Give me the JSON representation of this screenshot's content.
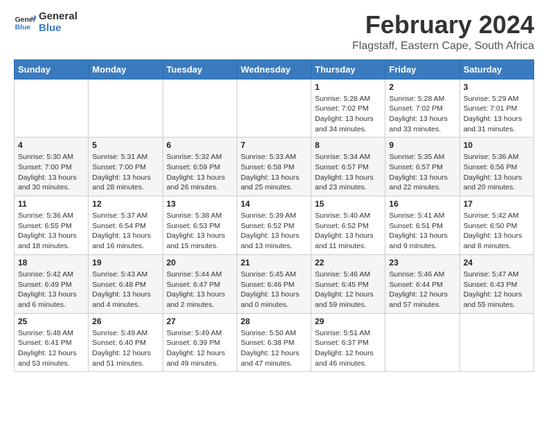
{
  "logo": {
    "text_general": "General",
    "text_blue": "Blue"
  },
  "header": {
    "title": "February 2024",
    "subtitle": "Flagstaff, Eastern Cape, South Africa"
  },
  "days_of_week": [
    "Sunday",
    "Monday",
    "Tuesday",
    "Wednesday",
    "Thursday",
    "Friday",
    "Saturday"
  ],
  "weeks": [
    {
      "cells": [
        {
          "day": "",
          "info": ""
        },
        {
          "day": "",
          "info": ""
        },
        {
          "day": "",
          "info": ""
        },
        {
          "day": "",
          "info": ""
        },
        {
          "day": "1",
          "info": "Sunrise: 5:28 AM\nSunset: 7:02 PM\nDaylight: 13 hours\nand 34 minutes."
        },
        {
          "day": "2",
          "info": "Sunrise: 5:28 AM\nSunset: 7:02 PM\nDaylight: 13 hours\nand 33 minutes."
        },
        {
          "day": "3",
          "info": "Sunrise: 5:29 AM\nSunset: 7:01 PM\nDaylight: 13 hours\nand 31 minutes."
        }
      ]
    },
    {
      "cells": [
        {
          "day": "4",
          "info": "Sunrise: 5:30 AM\nSunset: 7:00 PM\nDaylight: 13 hours\nand 30 minutes."
        },
        {
          "day": "5",
          "info": "Sunrise: 5:31 AM\nSunset: 7:00 PM\nDaylight: 13 hours\nand 28 minutes."
        },
        {
          "day": "6",
          "info": "Sunrise: 5:32 AM\nSunset: 6:59 PM\nDaylight: 13 hours\nand 26 minutes."
        },
        {
          "day": "7",
          "info": "Sunrise: 5:33 AM\nSunset: 6:58 PM\nDaylight: 13 hours\nand 25 minutes."
        },
        {
          "day": "8",
          "info": "Sunrise: 5:34 AM\nSunset: 6:57 PM\nDaylight: 13 hours\nand 23 minutes."
        },
        {
          "day": "9",
          "info": "Sunrise: 5:35 AM\nSunset: 6:57 PM\nDaylight: 13 hours\nand 22 minutes."
        },
        {
          "day": "10",
          "info": "Sunrise: 5:36 AM\nSunset: 6:56 PM\nDaylight: 13 hours\nand 20 minutes."
        }
      ]
    },
    {
      "cells": [
        {
          "day": "11",
          "info": "Sunrise: 5:36 AM\nSunset: 6:55 PM\nDaylight: 13 hours\nand 18 minutes."
        },
        {
          "day": "12",
          "info": "Sunrise: 5:37 AM\nSunset: 6:54 PM\nDaylight: 13 hours\nand 16 minutes."
        },
        {
          "day": "13",
          "info": "Sunrise: 5:38 AM\nSunset: 6:53 PM\nDaylight: 13 hours\nand 15 minutes."
        },
        {
          "day": "14",
          "info": "Sunrise: 5:39 AM\nSunset: 6:52 PM\nDaylight: 13 hours\nand 13 minutes."
        },
        {
          "day": "15",
          "info": "Sunrise: 5:40 AM\nSunset: 6:52 PM\nDaylight: 13 hours\nand 11 minutes."
        },
        {
          "day": "16",
          "info": "Sunrise: 5:41 AM\nSunset: 6:51 PM\nDaylight: 13 hours\nand 9 minutes."
        },
        {
          "day": "17",
          "info": "Sunrise: 5:42 AM\nSunset: 6:50 PM\nDaylight: 13 hours\nand 8 minutes."
        }
      ]
    },
    {
      "cells": [
        {
          "day": "18",
          "info": "Sunrise: 5:42 AM\nSunset: 6:49 PM\nDaylight: 13 hours\nand 6 minutes."
        },
        {
          "day": "19",
          "info": "Sunrise: 5:43 AM\nSunset: 6:48 PM\nDaylight: 13 hours\nand 4 minutes."
        },
        {
          "day": "20",
          "info": "Sunrise: 5:44 AM\nSunset: 6:47 PM\nDaylight: 13 hours\nand 2 minutes."
        },
        {
          "day": "21",
          "info": "Sunrise: 5:45 AM\nSunset: 6:46 PM\nDaylight: 13 hours\nand 0 minutes."
        },
        {
          "day": "22",
          "info": "Sunrise: 5:46 AM\nSunset: 6:45 PM\nDaylight: 12 hours\nand 59 minutes."
        },
        {
          "day": "23",
          "info": "Sunrise: 5:46 AM\nSunset: 6:44 PM\nDaylight: 12 hours\nand 57 minutes."
        },
        {
          "day": "24",
          "info": "Sunrise: 5:47 AM\nSunset: 6:43 PM\nDaylight: 12 hours\nand 55 minutes."
        }
      ]
    },
    {
      "cells": [
        {
          "day": "25",
          "info": "Sunrise: 5:48 AM\nSunset: 6:41 PM\nDaylight: 12 hours\nand 53 minutes."
        },
        {
          "day": "26",
          "info": "Sunrise: 5:49 AM\nSunset: 6:40 PM\nDaylight: 12 hours\nand 51 minutes."
        },
        {
          "day": "27",
          "info": "Sunrise: 5:49 AM\nSunset: 6:39 PM\nDaylight: 12 hours\nand 49 minutes."
        },
        {
          "day": "28",
          "info": "Sunrise: 5:50 AM\nSunset: 6:38 PM\nDaylight: 12 hours\nand 47 minutes."
        },
        {
          "day": "29",
          "info": "Sunrise: 5:51 AM\nSunset: 6:37 PM\nDaylight: 12 hours\nand 46 minutes."
        },
        {
          "day": "",
          "info": ""
        },
        {
          "day": "",
          "info": ""
        }
      ]
    }
  ]
}
